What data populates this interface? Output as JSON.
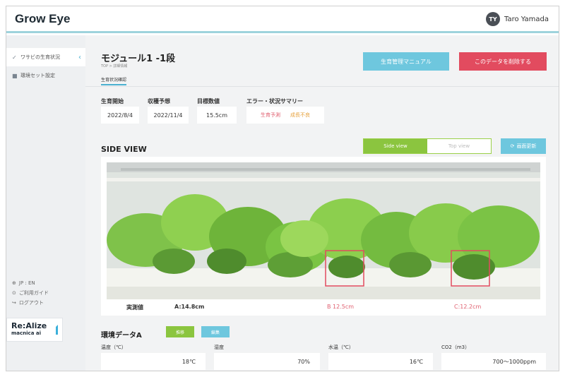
{
  "header": {
    "brand": "Grow Eye",
    "avatar_initials": "TY",
    "user_name": "Taro Yamada"
  },
  "sidebar": {
    "items": [
      {
        "label": "ワサビの生育状況",
        "icon": "leaf-icon"
      },
      {
        "label": "環境セット設定",
        "icon": "folder-icon"
      }
    ],
    "bottom": [
      {
        "icon": "globe-icon",
        "label": "JP : EN"
      },
      {
        "icon": "help-icon",
        "label": "ご利用ガイド"
      },
      {
        "icon": "logout-icon",
        "label": "ログアウト"
      }
    ],
    "logo_line1": "Re:Alize",
    "logo_line2": "macnica ai"
  },
  "main": {
    "title": "モジュール1 -1段",
    "breadcrumb": "TOP  >  詳細情報",
    "tab": "生育状況確認",
    "manual_button": "生育管理マニュアル",
    "delete_button": "このデータを削除する",
    "stats": [
      {
        "label": "生育開始",
        "value": "2022/8/4"
      },
      {
        "label": "収穫予想",
        "value": "2022/11/4"
      },
      {
        "label": "目標数値",
        "value": "15.5cm"
      }
    ],
    "status_label": "エラー・状況サマリー",
    "status_a": "生育予測",
    "status_b": "成長不良",
    "side_view_title": "SIDE VIEW",
    "toggle_side": "Side view",
    "toggle_top": "Top view",
    "refresh_button": "画面更新",
    "measure_label": "実測値",
    "measure_a": "A:14.8cm",
    "measure_b": "B 12.5cm",
    "measure_c": "C:12.2cm",
    "env_title": "環境データA",
    "env_btn_green": "推移",
    "env_btn_blue": "編集",
    "env": [
      {
        "label": "温度（℃）",
        "value": "18℃"
      },
      {
        "label": "湿度",
        "value": "70%"
      },
      {
        "label": "水温（℃）",
        "value": "16℃"
      },
      {
        "label": "CO2（m3）",
        "value": "700〜1000ppm"
      }
    ]
  },
  "colors": {
    "accent": "#6ec7de",
    "danger": "#e24b5f",
    "green": "#8bc53f",
    "alert": "#e06070"
  }
}
